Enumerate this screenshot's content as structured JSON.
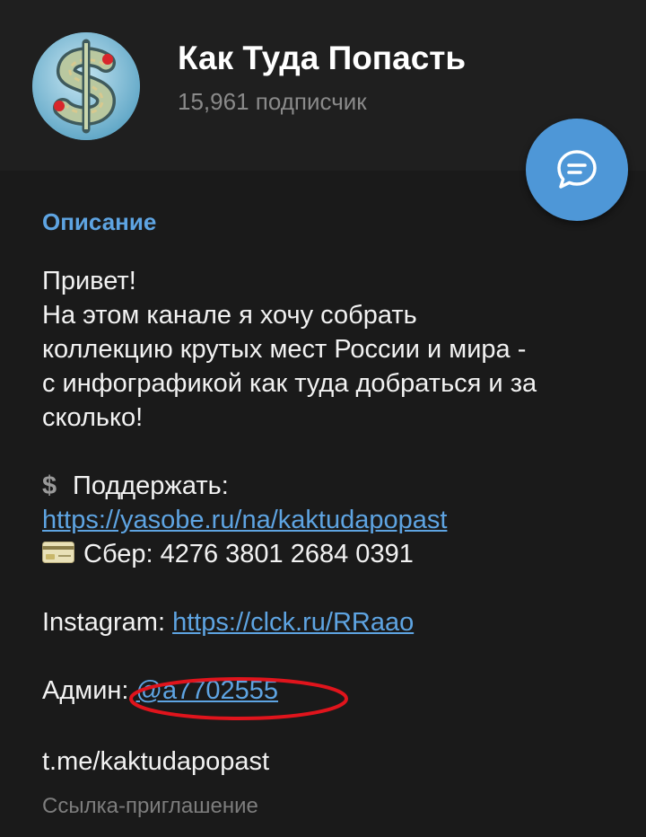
{
  "channel": {
    "title": "Как Туда Попасть",
    "subscribers": "15,961 подписчик"
  },
  "description": {
    "label": "Описание",
    "lines": [
      "Привет!",
      "На этом канале я хочу собрать",
      "коллекцию крутых мест России и мира -",
      "с инфографикой как туда добраться и за",
      "сколько!"
    ],
    "support_label": "Поддержать:",
    "support_link": "https://yasobe.ru/na/kaktudapopast",
    "sber_text": "Сбер: 4276 3801 2684 0391",
    "instagram_label": "Instagram:",
    "instagram_link": "https://clck.ru/RRaao",
    "admin_label": "Админ:",
    "admin_handle": "@a7702555"
  },
  "invite": {
    "link": "t.me/kaktudapopast",
    "caption": "Ссылка-приглашение"
  },
  "icons": {
    "dollar": "dollar-sign-icon",
    "card": "credit-card-icon",
    "fab": "chat-bubble-icon"
  },
  "colors": {
    "accent": "#5ea4e2",
    "fab": "#4e97d7",
    "annotation": "#e0141c"
  }
}
